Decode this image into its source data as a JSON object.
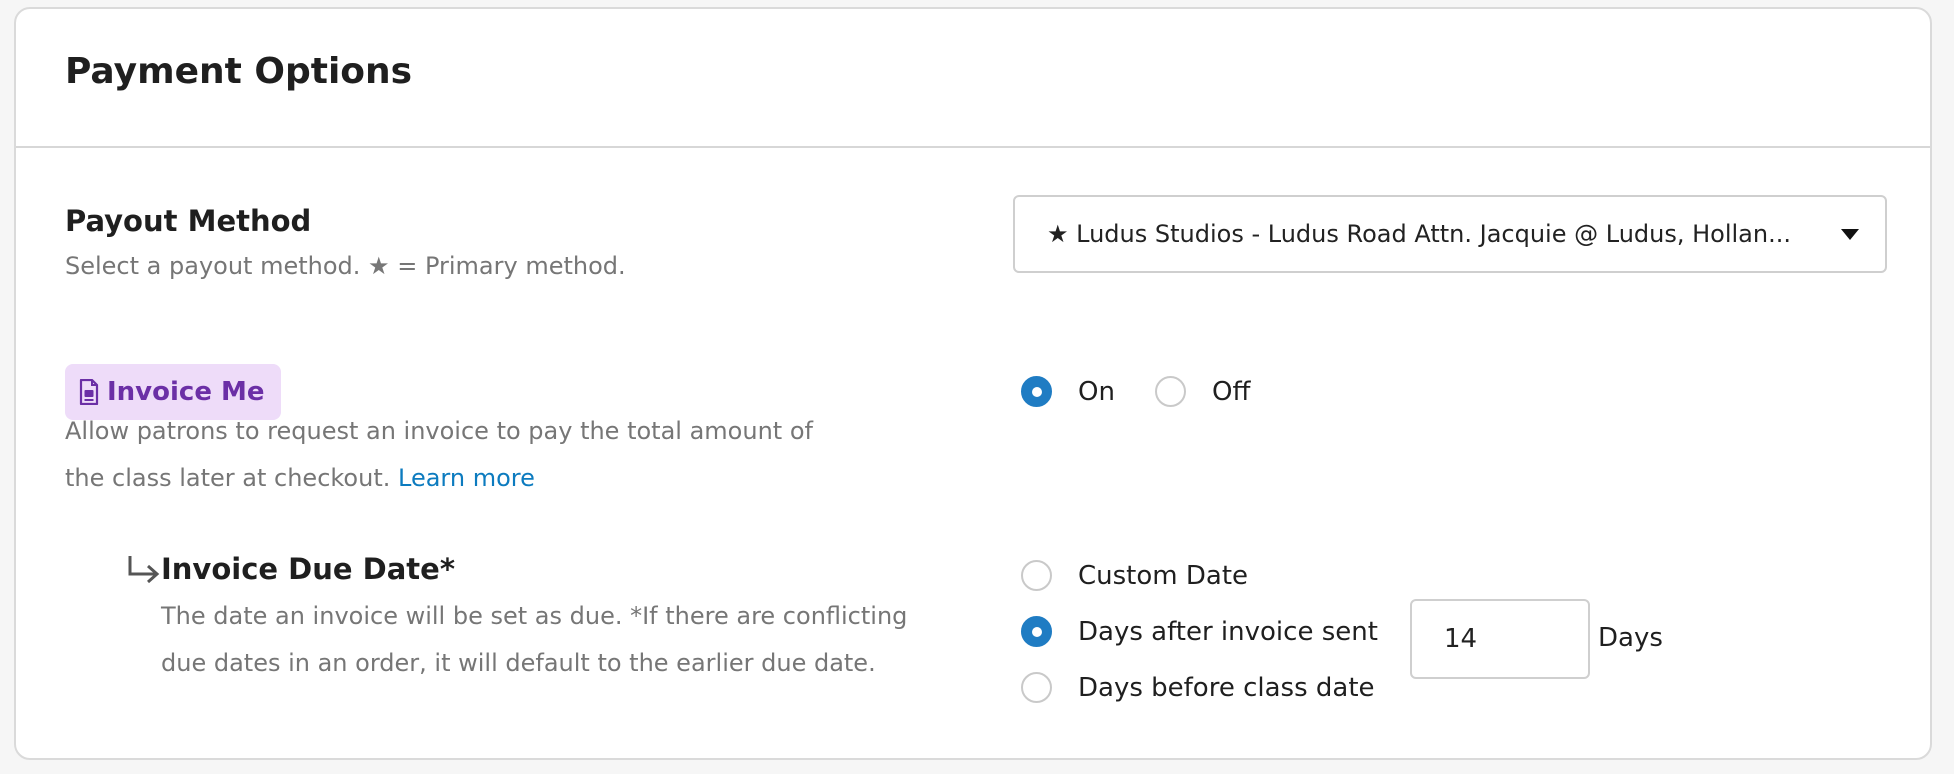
{
  "card": {
    "title": "Payment Options"
  },
  "payout": {
    "title": "Payout Method",
    "description_prefix": "Select a payout method.",
    "star_glyph": "★",
    "description_suffix": "= Primary method.",
    "selected": "★ Ludus Studios - Ludus Road Attn. Jacquie @ Ludus, Hollan...",
    "caret_icon": "caret-down-icon"
  },
  "invoice": {
    "badge_label": "Invoice Me",
    "badge_icon": "document-icon",
    "badge_bg": "#eedcf9",
    "badge_color": "#6b2fa6",
    "description_line1": "Allow patrons to request an invoice to pay the total amount of",
    "description_line2": "the class later at checkout.",
    "learn_more": "Learn more",
    "options": [
      {
        "label": "On",
        "checked": true
      },
      {
        "label": "Off",
        "checked": false
      }
    ]
  },
  "due_date": {
    "title": "Invoice Due Date*",
    "description_line1": "The date an invoice will be set as due. *If there are conflicting",
    "description_line2": "due dates in an order, it will default to the earlier due date.",
    "options": [
      {
        "label": "Custom Date",
        "checked": false
      },
      {
        "label": "Days after invoice sent",
        "checked": true
      },
      {
        "label": "Days before class date",
        "checked": false
      }
    ],
    "days_value": "14",
    "days_unit": "Days"
  },
  "colors": {
    "accent": "#1f7cc3",
    "link": "#0c7bbf"
  }
}
